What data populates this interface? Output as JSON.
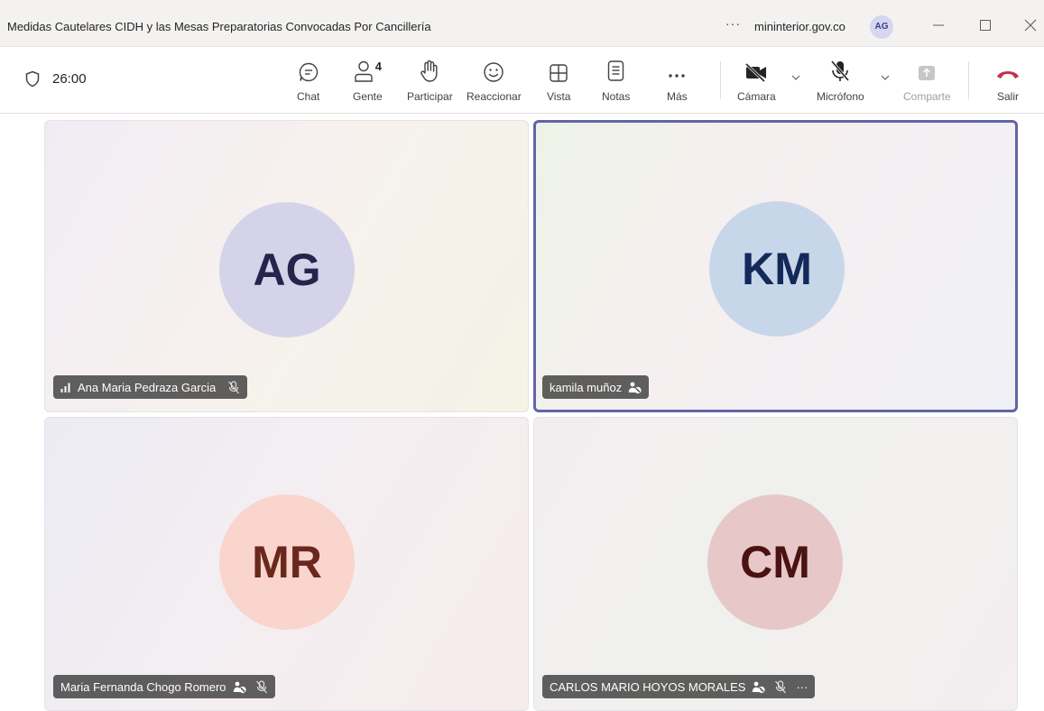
{
  "window": {
    "title": "Medidas Cautelares CIDH y las Mesas Preparatorias Convocadas Por Cancillería",
    "more_label": "···",
    "org": "mininterior.gov.co",
    "account_initials": "AG"
  },
  "toolbar": {
    "timer": "26:00",
    "people_count": "4",
    "chat_label": "Chat",
    "people_label": "Gente",
    "raise_label": "Participar",
    "react_label": "Reaccionar",
    "view_label": "Vista",
    "notes_label": "Notas",
    "more_label": "Más",
    "camera_label": "Cámara",
    "mic_label": "Micrófono",
    "share_label": "Comparte",
    "leave_label": "Salir"
  },
  "participants": [
    {
      "initials": "AG",
      "name": "Ana Maria Pedraza Garcia",
      "speaking": true,
      "muted": true,
      "no_camera": false
    },
    {
      "initials": "KM",
      "name": "kamila muñoz",
      "active": true,
      "muted": false,
      "no_camera": true
    },
    {
      "initials": "MR",
      "name": "Maria Fernanda Chogo Romero",
      "muted": true,
      "no_camera": true
    },
    {
      "initials": "CM",
      "name": "CARLOS MARIO HOYOS MORALES",
      "muted": true,
      "no_camera": true,
      "more": "···"
    }
  ],
  "colors": {
    "accent": "#6264a7",
    "leave": "#c4314b",
    "avatar_ag": "#d5d3e9",
    "avatar_km": "#c8d6ea",
    "avatar_mr": "#f9d5cd",
    "avatar_cm": "#e7c7c7"
  },
  "icons": [
    "shield-icon",
    "chat-icon",
    "people-icon",
    "hand-icon",
    "smile-icon",
    "grid-icon",
    "notes-icon",
    "more-icon",
    "camera-off-icon",
    "mic-off-icon",
    "share-icon",
    "phone-hangup-icon",
    "signal-icon",
    "no-camera-icon",
    "chevron-down-icon",
    "minimize-icon",
    "maximize-icon",
    "close-icon"
  ]
}
